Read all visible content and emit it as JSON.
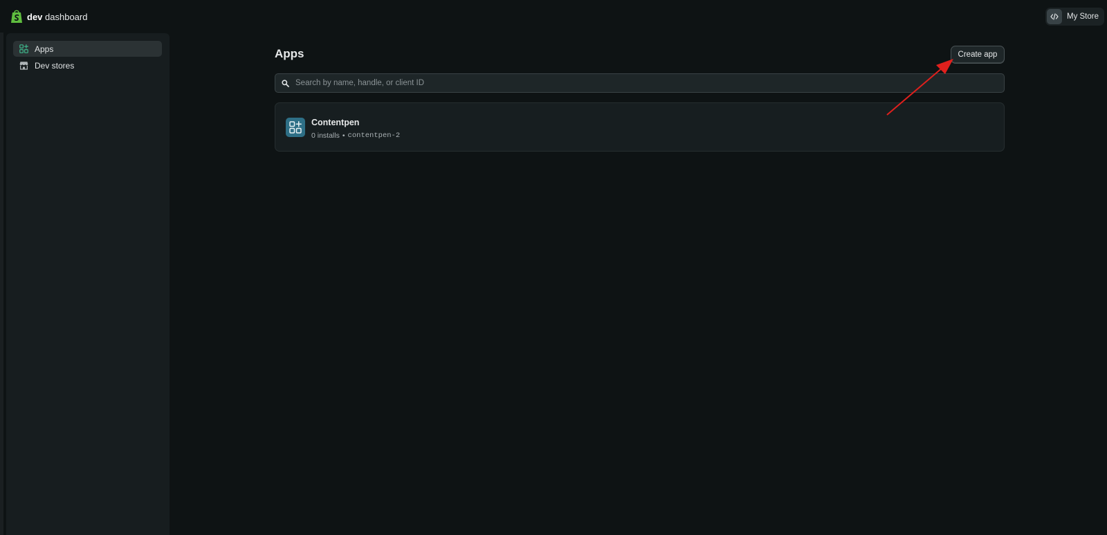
{
  "brand": {
    "bold": "dev",
    "rest": " dashboard",
    "logo_icon": "shopify-bag-icon",
    "accent": "#5fbd3f"
  },
  "store_switcher": {
    "label": "My Store",
    "icon": "code-icon"
  },
  "sidebar": {
    "items": [
      {
        "label": "Apps",
        "icon": "apps-grid-icon",
        "active": true
      },
      {
        "label": "Dev stores",
        "icon": "store-icon",
        "active": false
      }
    ]
  },
  "main": {
    "title": "Apps",
    "create_button": "Create app",
    "search": {
      "placeholder": "Search by name, handle, or client ID",
      "value": ""
    },
    "apps": [
      {
        "name": "Contentpen",
        "installs": "0 installs",
        "separator": "•",
        "handle": "contentpen-2",
        "icon": "apps-grid-icon",
        "icon_color": "#2e6f86"
      }
    ]
  },
  "annotation": {
    "type": "arrow",
    "color": "#e0201d",
    "points_to": "create-app-button"
  }
}
